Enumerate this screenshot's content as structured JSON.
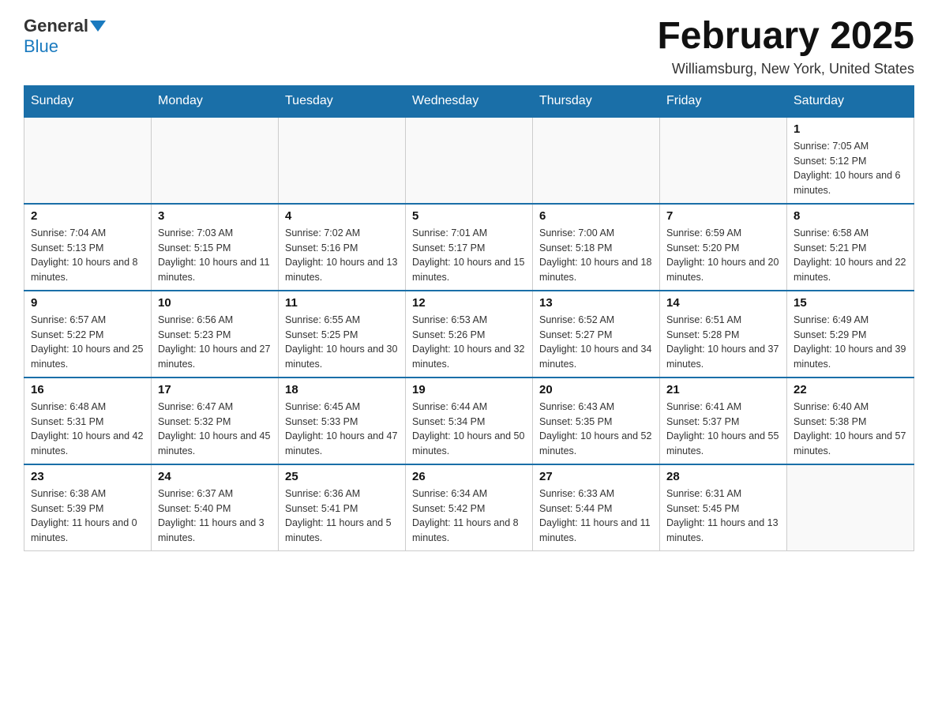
{
  "header": {
    "logo_general": "General",
    "logo_blue": "Blue",
    "month_title": "February 2025",
    "location": "Williamsburg, New York, United States"
  },
  "weekdays": [
    "Sunday",
    "Monday",
    "Tuesday",
    "Wednesday",
    "Thursday",
    "Friday",
    "Saturday"
  ],
  "weeks": [
    [
      {
        "day": "",
        "info": ""
      },
      {
        "day": "",
        "info": ""
      },
      {
        "day": "",
        "info": ""
      },
      {
        "day": "",
        "info": ""
      },
      {
        "day": "",
        "info": ""
      },
      {
        "day": "",
        "info": ""
      },
      {
        "day": "1",
        "info": "Sunrise: 7:05 AM\nSunset: 5:12 PM\nDaylight: 10 hours and 6 minutes."
      }
    ],
    [
      {
        "day": "2",
        "info": "Sunrise: 7:04 AM\nSunset: 5:13 PM\nDaylight: 10 hours and 8 minutes."
      },
      {
        "day": "3",
        "info": "Sunrise: 7:03 AM\nSunset: 5:15 PM\nDaylight: 10 hours and 11 minutes."
      },
      {
        "day": "4",
        "info": "Sunrise: 7:02 AM\nSunset: 5:16 PM\nDaylight: 10 hours and 13 minutes."
      },
      {
        "day": "5",
        "info": "Sunrise: 7:01 AM\nSunset: 5:17 PM\nDaylight: 10 hours and 15 minutes."
      },
      {
        "day": "6",
        "info": "Sunrise: 7:00 AM\nSunset: 5:18 PM\nDaylight: 10 hours and 18 minutes."
      },
      {
        "day": "7",
        "info": "Sunrise: 6:59 AM\nSunset: 5:20 PM\nDaylight: 10 hours and 20 minutes."
      },
      {
        "day": "8",
        "info": "Sunrise: 6:58 AM\nSunset: 5:21 PM\nDaylight: 10 hours and 22 minutes."
      }
    ],
    [
      {
        "day": "9",
        "info": "Sunrise: 6:57 AM\nSunset: 5:22 PM\nDaylight: 10 hours and 25 minutes."
      },
      {
        "day": "10",
        "info": "Sunrise: 6:56 AM\nSunset: 5:23 PM\nDaylight: 10 hours and 27 minutes."
      },
      {
        "day": "11",
        "info": "Sunrise: 6:55 AM\nSunset: 5:25 PM\nDaylight: 10 hours and 30 minutes."
      },
      {
        "day": "12",
        "info": "Sunrise: 6:53 AM\nSunset: 5:26 PM\nDaylight: 10 hours and 32 minutes."
      },
      {
        "day": "13",
        "info": "Sunrise: 6:52 AM\nSunset: 5:27 PM\nDaylight: 10 hours and 34 minutes."
      },
      {
        "day": "14",
        "info": "Sunrise: 6:51 AM\nSunset: 5:28 PM\nDaylight: 10 hours and 37 minutes."
      },
      {
        "day": "15",
        "info": "Sunrise: 6:49 AM\nSunset: 5:29 PM\nDaylight: 10 hours and 39 minutes."
      }
    ],
    [
      {
        "day": "16",
        "info": "Sunrise: 6:48 AM\nSunset: 5:31 PM\nDaylight: 10 hours and 42 minutes."
      },
      {
        "day": "17",
        "info": "Sunrise: 6:47 AM\nSunset: 5:32 PM\nDaylight: 10 hours and 45 minutes."
      },
      {
        "day": "18",
        "info": "Sunrise: 6:45 AM\nSunset: 5:33 PM\nDaylight: 10 hours and 47 minutes."
      },
      {
        "day": "19",
        "info": "Sunrise: 6:44 AM\nSunset: 5:34 PM\nDaylight: 10 hours and 50 minutes."
      },
      {
        "day": "20",
        "info": "Sunrise: 6:43 AM\nSunset: 5:35 PM\nDaylight: 10 hours and 52 minutes."
      },
      {
        "day": "21",
        "info": "Sunrise: 6:41 AM\nSunset: 5:37 PM\nDaylight: 10 hours and 55 minutes."
      },
      {
        "day": "22",
        "info": "Sunrise: 6:40 AM\nSunset: 5:38 PM\nDaylight: 10 hours and 57 minutes."
      }
    ],
    [
      {
        "day": "23",
        "info": "Sunrise: 6:38 AM\nSunset: 5:39 PM\nDaylight: 11 hours and 0 minutes."
      },
      {
        "day": "24",
        "info": "Sunrise: 6:37 AM\nSunset: 5:40 PM\nDaylight: 11 hours and 3 minutes."
      },
      {
        "day": "25",
        "info": "Sunrise: 6:36 AM\nSunset: 5:41 PM\nDaylight: 11 hours and 5 minutes."
      },
      {
        "day": "26",
        "info": "Sunrise: 6:34 AM\nSunset: 5:42 PM\nDaylight: 11 hours and 8 minutes."
      },
      {
        "day": "27",
        "info": "Sunrise: 6:33 AM\nSunset: 5:44 PM\nDaylight: 11 hours and 11 minutes."
      },
      {
        "day": "28",
        "info": "Sunrise: 6:31 AM\nSunset: 5:45 PM\nDaylight: 11 hours and 13 minutes."
      },
      {
        "day": "",
        "info": ""
      }
    ]
  ]
}
